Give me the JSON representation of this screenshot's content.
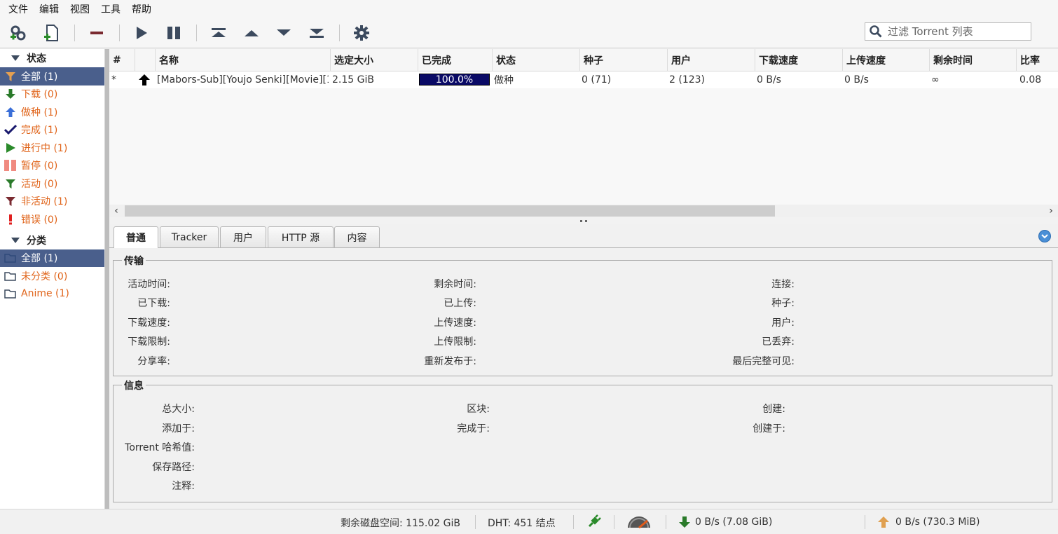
{
  "menu": [
    "文件",
    "编辑",
    "视图",
    "工具",
    "帮助"
  ],
  "toolbar": {
    "filter_placeholder": "过滤 Torrent 列表",
    "buttons": [
      "add-torrent-link",
      "add-torrent-file",
      "remove",
      "resume",
      "pause",
      "move-top",
      "move-up",
      "move-down",
      "move-bottom",
      "options"
    ]
  },
  "sidebar": {
    "status_header": "状态",
    "status_items": [
      {
        "label": "全部 (1)",
        "icon": "filter-icon"
      },
      {
        "label": "下载 (0)",
        "icon": "download-arrow-icon"
      },
      {
        "label": "做种 (1)",
        "icon": "upload-arrow-icon"
      },
      {
        "label": "完成 (1)",
        "icon": "checkmark-icon"
      },
      {
        "label": "进行中 (1)",
        "icon": "play-icon"
      },
      {
        "label": "暂停 (0)",
        "icon": "pause-icon"
      },
      {
        "label": "活动 (0)",
        "icon": "filter-active-icon"
      },
      {
        "label": "非活动 (1)",
        "icon": "filter-inactive-icon"
      },
      {
        "label": "错误 (0)",
        "icon": "error-icon"
      }
    ],
    "category_header": "分类",
    "category_items": [
      {
        "label": "全部 (1)",
        "icon": "folder-icon"
      },
      {
        "label": "未分类 (0)",
        "icon": "folder-icon"
      },
      {
        "label": "Anime (1)",
        "icon": "folder-icon"
      }
    ]
  },
  "torrent_list": {
    "columns": [
      "#",
      "",
      "名称",
      "选定大小",
      "已完成",
      "状态",
      "种子",
      "用户",
      "下载速度",
      "上传速度",
      "剩余时间",
      "比率"
    ],
    "rows": [
      {
        "priority": "*",
        "name": "[Mabors-Sub][Youjo Senki][Movie][1…",
        "size": "2.15 GiB",
        "progress_label": "100.0%",
        "progress": 1.0,
        "status": "做种",
        "seeds": "0 (71)",
        "peers": "2 (123)",
        "down_speed": "0 B/s",
        "up_speed": "0 B/s",
        "eta": "∞",
        "ratio": "0.08"
      }
    ]
  },
  "details": {
    "tabs": [
      "普通",
      "Tracker",
      "用户",
      "HTTP 源",
      "内容"
    ],
    "transfer": {
      "title": "传输",
      "col1": [
        "活动时间:",
        "已下载:",
        "下载速度:",
        "下载限制:",
        "分享率:"
      ],
      "col2": [
        "剩余时间:",
        "已上传:",
        "上传速度:",
        "上传限制:",
        "重新发布于:"
      ],
      "col3": [
        "连接:",
        "种子:",
        "用户:",
        "已丢弃:",
        "最后完整可见:"
      ]
    },
    "info": {
      "title": "信息",
      "col1": [
        "总大小:",
        "添加于:",
        "Torrent 哈希值:",
        "保存路径:",
        "注释:"
      ],
      "col2": [
        "区块:",
        "完成于:"
      ],
      "col3": [
        "创建:",
        "创建于:"
      ]
    }
  },
  "statusbar": {
    "disk_space": "剩余磁盘空间: 115.02 GiB",
    "dht": "DHT: 451 结点",
    "download": "0 B/s (7.08 GiB)",
    "upload": "0 B/s (730.3 MiB)"
  },
  "colors": {
    "selected_bg": "#4a5f8c",
    "item_text": "#e0641a",
    "progress_fill": "#0a0a66"
  }
}
